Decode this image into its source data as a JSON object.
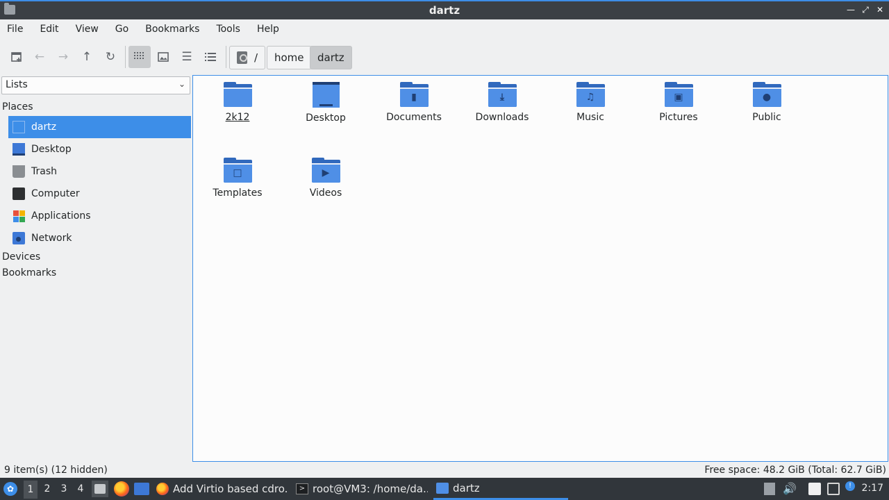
{
  "window": {
    "title": "dartz"
  },
  "menu": [
    "File",
    "Edit",
    "View",
    "Go",
    "Bookmarks",
    "Tools",
    "Help"
  ],
  "path": {
    "root": "/",
    "segments": [
      "home",
      "dartz"
    ]
  },
  "sidepane": {
    "mode": "Lists",
    "sections": {
      "places": "Places",
      "devices": "Devices",
      "bookmarks": "Bookmarks"
    },
    "places": [
      {
        "label": "dartz",
        "icon": "home-folder-icon"
      },
      {
        "label": "Desktop",
        "icon": "desktop-icon"
      },
      {
        "label": "Trash",
        "icon": "trash-icon"
      },
      {
        "label": "Computer",
        "icon": "computer-icon"
      },
      {
        "label": "Applications",
        "icon": "applications-icon"
      },
      {
        "label": "Network",
        "icon": "network-icon"
      }
    ]
  },
  "files": [
    {
      "name": "2k12",
      "icon": "folder-icon"
    },
    {
      "name": "Desktop",
      "icon": "desktop-folder-icon"
    },
    {
      "name": "Documents",
      "icon": "documents-folder-icon"
    },
    {
      "name": "Downloads",
      "icon": "downloads-folder-icon"
    },
    {
      "name": "Music",
      "icon": "music-folder-icon"
    },
    {
      "name": "Pictures",
      "icon": "pictures-folder-icon"
    },
    {
      "name": "Public",
      "icon": "public-folder-icon"
    },
    {
      "name": "Templates",
      "icon": "templates-folder-icon"
    },
    {
      "name": "Videos",
      "icon": "videos-folder-icon"
    }
  ],
  "status": {
    "items": "9 item(s) (12 hidden)",
    "space": "Free space: 48.2 GiB (Total: 62.7 GiB)"
  },
  "taskbar": {
    "desktops": [
      "1",
      "2",
      "3",
      "4"
    ],
    "tasks": [
      {
        "label": "Add Virtio based cdro...",
        "icon": "firefox-icon"
      },
      {
        "label": "root@VM3: /home/da...",
        "icon": "terminal-icon"
      },
      {
        "label": "dartz",
        "icon": "folder-icon"
      }
    ],
    "clock": "2:17"
  },
  "colors": {
    "accent": "#3d8ee8",
    "folder": "#4f8fe6",
    "taskbar": "#31363b",
    "titlebar": "#3b4045"
  }
}
